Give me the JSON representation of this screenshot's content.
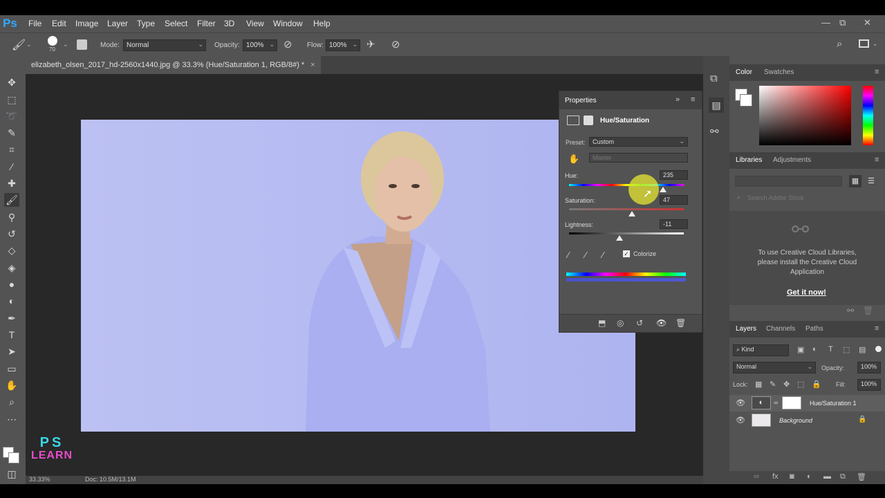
{
  "app": {
    "logo": "Ps"
  },
  "menu": [
    "File",
    "Edit",
    "Image",
    "Layer",
    "Type",
    "Select",
    "Filter",
    "3D",
    "View",
    "Window",
    "Help"
  ],
  "window_controls": {
    "minimize": "—",
    "restore": "⧉",
    "close": "✕"
  },
  "options": {
    "brush_size": "70",
    "mode_label": "Mode:",
    "mode_value": "Normal",
    "opacity_label": "Opacity:",
    "opacity_value": "100%",
    "flow_label": "Flow:",
    "flow_value": "100%"
  },
  "document": {
    "tab_title": "elizabeth_olsen_2017_hd-2560x1440.jpg @ 33.3% (Hue/Saturation 1, RGB/8#) *",
    "close": "×",
    "zoom": "33.33%",
    "doc_info": "Doc: 10.5M/13.1M",
    "canvas_color": "#b9bff1"
  },
  "properties": {
    "title": "Properties",
    "adjustment_name": "Hue/Saturation",
    "preset_label": "Preset:",
    "preset_value": "Custom",
    "channel_value": "Master",
    "hue_label": "Hue:",
    "hue_value": "235",
    "hue_fraction": 0.82,
    "saturation_label": "Saturation:",
    "saturation_value": "47",
    "saturation_fraction": 0.55,
    "lightness_label": "Lightness:",
    "lightness_value": "-11",
    "lightness_fraction": 0.44,
    "colorize_label": "Colorize",
    "colorize_checked": true
  },
  "right_panels": {
    "color_tabs": [
      "Color",
      "Swatches"
    ],
    "library_tabs": [
      "Libraries",
      "Adjustments"
    ],
    "library_search_placeholder": "Search Adobe Stock",
    "library_message": "To use Creative Cloud Libraries, please install the Creative Cloud Application",
    "library_link": "Get it now!",
    "layer_tabs": [
      "Layers",
      "Channels",
      "Paths"
    ],
    "kind_label": "Kind",
    "blend_mode": "Normal",
    "opacity_label": "Opacity:",
    "opacity_value": "100%",
    "lock_label": "Lock:",
    "fill_label": "Fill:",
    "fill_value": "100%",
    "layers": [
      {
        "name": "Hue/Saturation 1"
      },
      {
        "name": "Background"
      }
    ]
  },
  "watermark": {
    "line1": "PS",
    "line2": "LEARN"
  },
  "colors": {
    "accent": "#31a8ff",
    "panel": "#535353",
    "dark": "#282828"
  }
}
